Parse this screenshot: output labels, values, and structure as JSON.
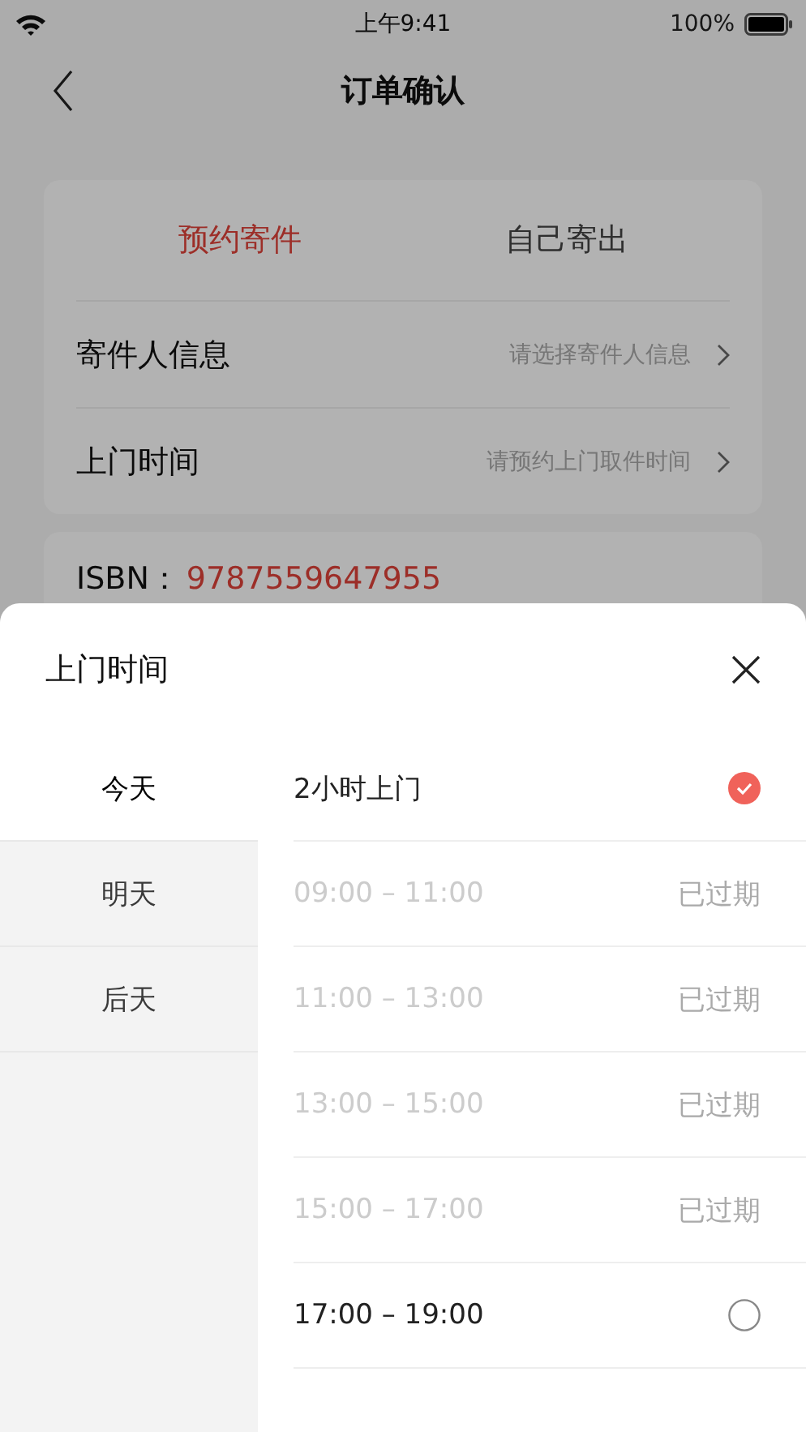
{
  "status_bar": {
    "time": "上午9:41",
    "battery_text": "100%"
  },
  "nav": {
    "title": "订单确认"
  },
  "mode_tabs": [
    {
      "label": "预约寄件",
      "selected": true
    },
    {
      "label": "自己寄出",
      "selected": false
    }
  ],
  "form_rows": [
    {
      "label": "寄件人信息",
      "placeholder": "请选择寄件人信息"
    },
    {
      "label": "上门时间",
      "placeholder": "请预约上门取件时间"
    }
  ],
  "isbn": {
    "label": "ISBN：",
    "value": "9787559647955"
  },
  "sheet": {
    "title": "上门时间",
    "days": [
      {
        "label": "今天",
        "selected": true
      },
      {
        "label": "明天",
        "selected": false
      },
      {
        "label": "后天",
        "selected": false
      }
    ],
    "slots": [
      {
        "kind": "available",
        "time": "2小时上门",
        "selected": true
      },
      {
        "kind": "expired",
        "time": "09:00 – 11:00",
        "status": "已过期"
      },
      {
        "kind": "expired",
        "time": "11:00 – 13:00",
        "status": "已过期"
      },
      {
        "kind": "expired",
        "time": "13:00 – 15:00",
        "status": "已过期"
      },
      {
        "kind": "expired",
        "time": "15:00 – 17:00",
        "status": "已过期"
      },
      {
        "kind": "available",
        "time": "17:00 – 19:00",
        "selected": false
      }
    ]
  }
}
